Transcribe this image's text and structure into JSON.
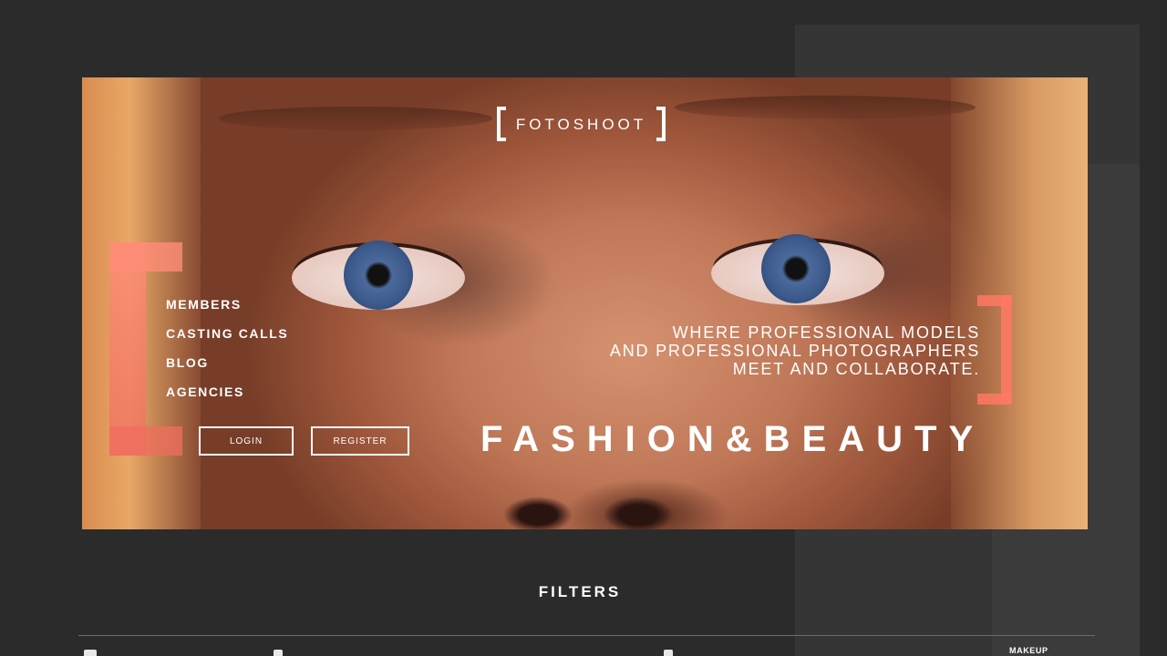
{
  "brand": {
    "name": "FOTOSHOOT"
  },
  "nav": {
    "items": [
      {
        "label": "MEMBERS"
      },
      {
        "label": "CASTING CALLS"
      },
      {
        "label": "BLOG"
      },
      {
        "label": "AGENCIES"
      }
    ]
  },
  "auth": {
    "login_label": "LOGIN",
    "register_label": "REGISTER"
  },
  "hero": {
    "tagline": [
      "WHERE PROFESSIONAL MODELS",
      "AND PROFESSIONAL PHOTOGRAPHERS",
      "MEET AND COLLABORATE."
    ],
    "headline": "FASHION&BEAUTY"
  },
  "filters": {
    "title": "FILTERS",
    "side_label": "MAKEUP"
  },
  "colors": {
    "background": "#2b2b2b",
    "accent": "#ff8c78",
    "text": "#ffffff",
    "divider": "#6b6b6b"
  }
}
